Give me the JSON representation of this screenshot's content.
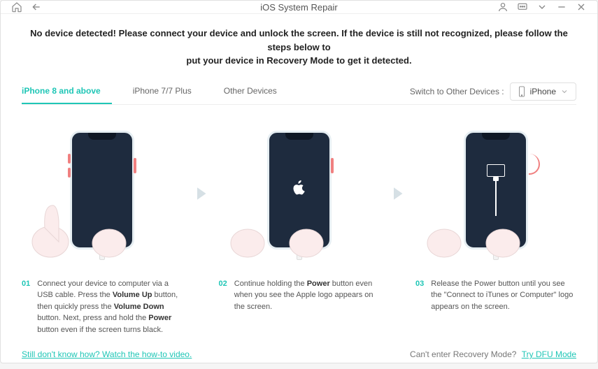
{
  "header": {
    "title": "iOS System Repair"
  },
  "alert": {
    "line1": "No device detected! Please connect your device and unlock the screen. If the device is still not recognized, please follow the steps below to",
    "line2": "put your device in Recovery Mode to get it detected."
  },
  "tabs": {
    "items": [
      {
        "label": "iPhone 8 and above",
        "active": true
      },
      {
        "label": "iPhone 7/7 Plus",
        "active": false
      },
      {
        "label": "Other Devices",
        "active": false
      }
    ],
    "switch_label": "Switch to Other Devices :",
    "device_selected": "iPhone"
  },
  "steps": [
    {
      "num": "01",
      "desc_html": "Connect your device to computer via a USB cable. Press the <b>Volume Up</b> button, then quickly press the <b>Volume Down</b> button. Next, press and hold the <b>Power</b> button even if the screen turns black."
    },
    {
      "num": "02",
      "desc_html": "Continue holding the <b>Power</b> button even when you see the Apple logo appears on the screen."
    },
    {
      "num": "03",
      "desc_html": "Release the Power button until you see the \"Connect to iTunes or Computer\" logo appears on the screen."
    }
  ],
  "footer": {
    "howto_link": "Still don't know how? Watch the how-to video.",
    "dfu_text": "Can't enter Recovery Mode?",
    "dfu_link": "Try DFU Mode"
  }
}
